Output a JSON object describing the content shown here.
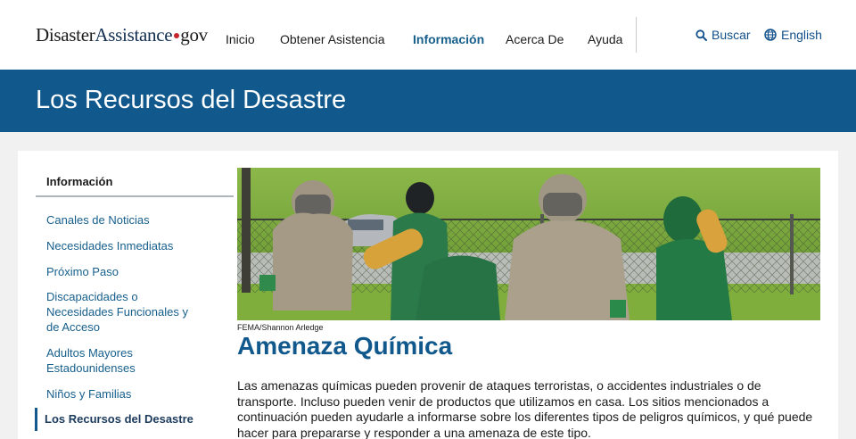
{
  "header": {
    "logo": {
      "part1": "Disaster",
      "part2": "Assistance",
      "part3": "gov"
    },
    "nav": [
      {
        "label": "Inicio"
      },
      {
        "label": "Obtener Asistencia"
      },
      {
        "label": "Información"
      },
      {
        "label": "Acerca De"
      },
      {
        "label": "Ayuda"
      }
    ],
    "search_label": "Buscar",
    "language_label": "English"
  },
  "banner": {
    "title": "Los Recursos del Desastre"
  },
  "sidebar": {
    "title": "Información",
    "items": [
      {
        "label": "Canales de Noticias"
      },
      {
        "label": "Necesidades Inmediatas"
      },
      {
        "label": "Próximo Paso"
      },
      {
        "label": "Discapacidades o Necesidades Funcionales y de Acceso"
      },
      {
        "label": "Adultos Mayores Estadounidenses"
      },
      {
        "label": "Niños y Familias"
      },
      {
        "label": "Los Recursos del Desastre"
      }
    ]
  },
  "main": {
    "image_credit": "FEMA/Shannon Arledge",
    "title": "Amenaza Química",
    "body": "Las amenazas químicas pueden provenir de ataques terroristas, o accidentes industriales o de transporte. Incluso pueden venir de productos que utilizamos en casa. Los sitios mencionados a continuación pueden ayudarle a informarse sobre los diferentes tipos de peligros químicos, y qué puede hacer para prepararse y responder a una amenaza de este tipo."
  },
  "colors": {
    "banner": "#11598c",
    "link": "#165f8d",
    "title": "#11598c",
    "logo_dot": "#c9252c"
  }
}
